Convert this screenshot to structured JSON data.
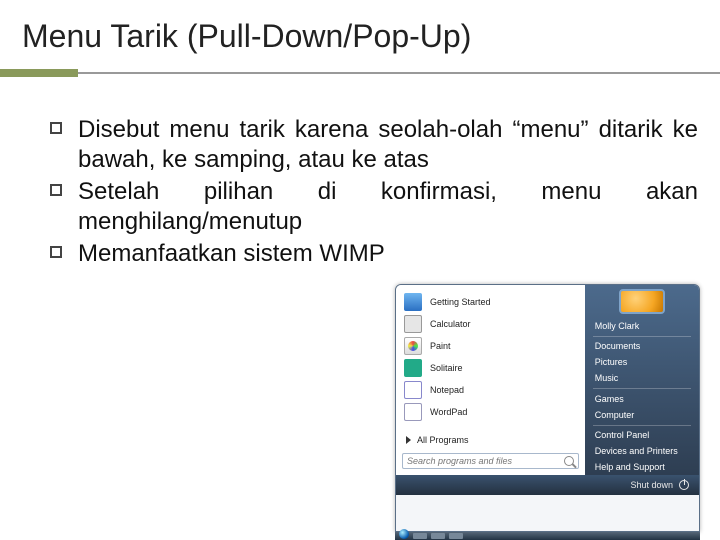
{
  "title": "Menu Tarik (Pull-Down/Pop-Up)",
  "bullets": [
    "Disebut menu tarik karena seolah-olah “menu” ditarik ke bawah, ke samping, atau ke atas",
    "Setelah pilihan di konfirmasi, menu akan menghilang/menutup",
    "Memanfaatkan sistem WIMP"
  ],
  "startmenu": {
    "left_items": [
      {
        "label": "Getting Started",
        "icon": "ic-gs"
      },
      {
        "label": "Calculator",
        "icon": "ic-calc"
      },
      {
        "label": "Paint",
        "icon": "ic-paint"
      },
      {
        "label": "Solitaire",
        "icon": "ic-sol"
      },
      {
        "label": "Notepad",
        "icon": "ic-note"
      },
      {
        "label": "WordPad",
        "icon": "ic-word"
      }
    ],
    "all_programs": "All Programs",
    "search_placeholder": "Search programs and files",
    "user": "Molly Clark",
    "right_items": [
      "Documents",
      "Pictures",
      "Music",
      "Games",
      "Computer",
      "Control Panel",
      "Devices and Printers",
      "Help and Support"
    ],
    "shutdown": "Shut down"
  }
}
